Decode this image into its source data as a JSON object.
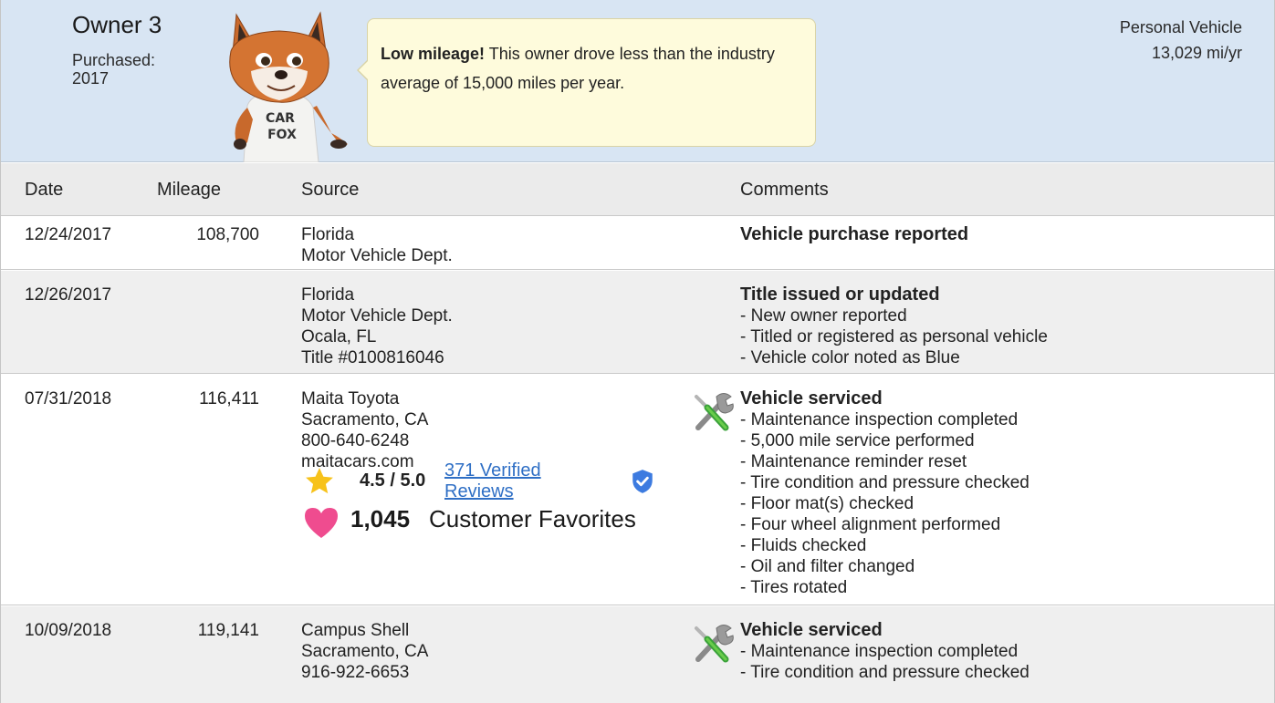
{
  "owner": {
    "title": "Owner 3",
    "purchased_label": "Purchased:",
    "purchased_year": "2017",
    "callout_bold": "Low mileage!",
    "callout_text": " This owner drove less than the industry average of 15,000 miles per year.",
    "usage_type": "Personal Vehicle",
    "usage_miles": "13,029 mi/yr",
    "mascot_text": "CAR FOX"
  },
  "columns": {
    "date": "Date",
    "mileage": "Mileage",
    "source": "Source",
    "comments": "Comments"
  },
  "records": [
    {
      "date": "12/24/2017",
      "mileage": "108,700",
      "source": [
        "Florida",
        "Motor Vehicle Dept."
      ],
      "comment_head": "Vehicle purchase reported",
      "comment_items": []
    },
    {
      "date": "12/26/2017",
      "mileage": "",
      "source": [
        "Florida",
        "Motor Vehicle Dept.",
        "Ocala, FL",
        "Title #0100816046"
      ],
      "comment_head": "Title issued or updated",
      "comment_items": [
        "- New owner reported",
        "- Titled or registered as personal vehicle",
        "- Vehicle color noted as Blue"
      ]
    },
    {
      "date": "07/31/2018",
      "mileage": "116,411",
      "source": [
        "Maita Toyota",
        "Sacramento, CA",
        "800-640-6248",
        "maitacars.com"
      ],
      "rating": "4.5 / 5.0",
      "reviews": "371 Verified Reviews",
      "favorites_count": "1,045",
      "favorites_label": "Customer Favorites",
      "comment_head": "Vehicle serviced",
      "comment_items": [
        "- Maintenance inspection completed",
        "- 5,000 mile service performed",
        "- Maintenance reminder reset",
        "- Tire condition and pressure checked",
        "- Floor mat(s) checked",
        "- Four wheel alignment performed",
        "- Fluids checked",
        "- Oil and filter changed",
        "- Tires rotated"
      ]
    },
    {
      "date": "10/09/2018",
      "mileage": "119,141",
      "source": [
        "Campus Shell",
        "Sacramento, CA",
        "916-922-6653"
      ],
      "comment_head": "Vehicle serviced",
      "comment_items": [
        "- Maintenance inspection completed",
        "- Tire condition and pressure checked"
      ]
    }
  ],
  "icons": {
    "service": "wrench-screwdriver-icon",
    "star": "star-icon",
    "verified": "verified-shield-icon",
    "favorite": "heart-icon"
  },
  "colors": {
    "header_bg": "#d8e5f3",
    "callout_bg": "#fefbdc",
    "link": "#2f6fc5",
    "star": "#f7c21a",
    "heart": "#ef4c8f",
    "shield": "#3d7be0"
  }
}
